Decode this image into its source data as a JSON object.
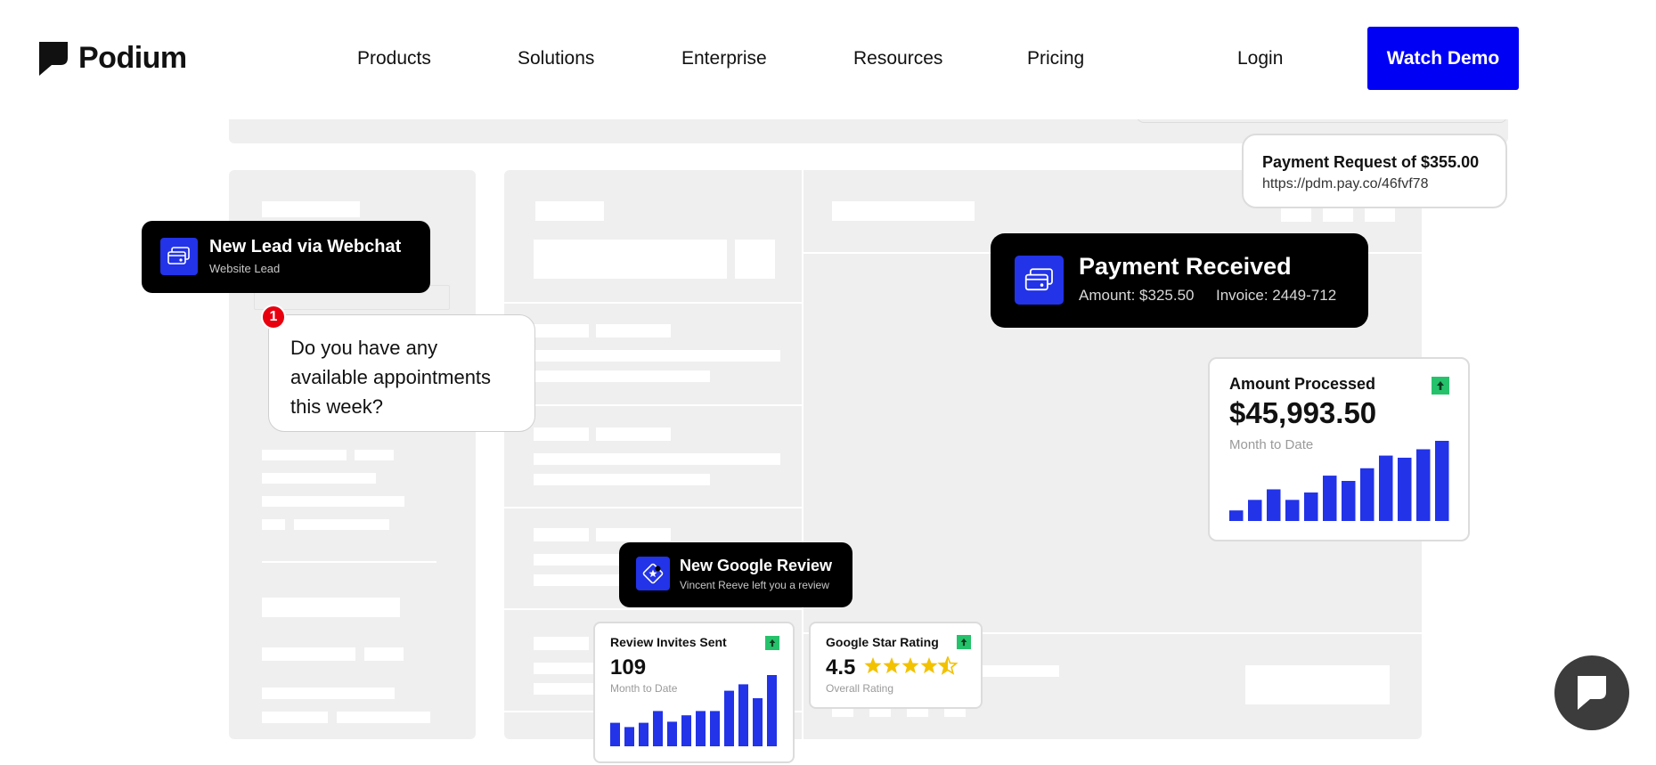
{
  "brand": {
    "name": "Podium"
  },
  "nav": {
    "links": [
      "Products",
      "Solutions",
      "Enterprise",
      "Resources",
      "Pricing"
    ],
    "login": "Login",
    "cta": "Watch Demo"
  },
  "webchat_card": {
    "title": "New Lead via Webchat",
    "subtitle": "Website Lead",
    "icon": "credit-card-icon"
  },
  "chat_bubble": {
    "badge": "1",
    "text": "Do you have any available appointments this week?"
  },
  "payment_request": {
    "title": "Payment Request of $355.00",
    "link": "https://pdm.pay.co/46fvf78"
  },
  "payment_received": {
    "title": "Payment Received",
    "amount": "Amount: $325.50",
    "invoice": "Invoice: 2449-712",
    "icon": "credit-card-icon"
  },
  "google_review": {
    "title": "New Google Review",
    "subtitle": "Vincent Reeve left you a review",
    "icon": "star-tag-icon"
  },
  "amount_processed": {
    "title": "Amount Processed",
    "value": "$45,993.50",
    "caption": "Month to Date",
    "trend": "up-arrow-icon",
    "chart_data": {
      "type": "bar",
      "values": [
        10,
        20,
        30,
        20,
        27,
        43,
        38,
        50,
        62,
        60,
        68,
        76
      ],
      "color": "#2233e8"
    }
  },
  "review_invites": {
    "title": "Review Invites Sent",
    "value": "109",
    "caption": "Month to Date",
    "trend": "up-arrow-icon",
    "chart_data": {
      "type": "bar",
      "values": [
        22,
        18,
        22,
        33,
        23,
        29,
        33,
        33,
        52,
        58,
        45,
        70
      ],
      "color": "#2233e8"
    }
  },
  "star_rating": {
    "title": "Google Star Rating",
    "value": "4.5",
    "stars": 4.5,
    "caption": "Overall Rating",
    "trend": "up-arrow-icon",
    "star_color": "#f2c200"
  },
  "chat_widget": {
    "icon": "podium-chat-icon"
  },
  "colors": {
    "accent": "#0000f5",
    "brand_blue": "#2233e8",
    "trend_green": "#26c26b",
    "notification_red": "#e8000f"
  }
}
